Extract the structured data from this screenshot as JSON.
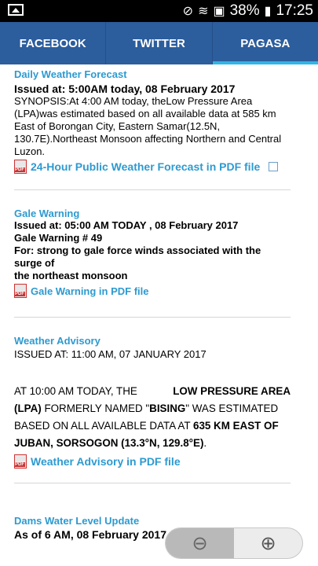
{
  "status_bar": {
    "battery": "38%",
    "time": "17:25",
    "icons": [
      "gallery-icon",
      "muted-icon",
      "wifi-icon",
      "no-sim-icon",
      "battery-charging-icon"
    ]
  },
  "tabs": [
    {
      "label": "FACEBOOK"
    },
    {
      "label": "TWITTER"
    },
    {
      "label": "PAGASA",
      "active": true
    }
  ],
  "forecast": {
    "title": "Daily Weather Forecast",
    "issued": "Issued at: 5:00AM today, 08 February 2017",
    "synopsis_lines": [
      "SYNOPSIS:At 4:00 AM today, theLow Pressure Area",
      "(LPA)was estimated based on all available data at 585 km",
      "East of Borongan City, Eastern Samar(12.5N,",
      "130.7E).Northeast Monsoon affecting Northern and Central",
      "Luzon."
    ],
    "pdf_link": "24-Hour Public Weather Forecast in PDF file"
  },
  "gale": {
    "title": "Gale Warning",
    "issued": "Issued at: 05:00 AM TODAY , 08 February 2017",
    "number": "Gale Warning # 49",
    "for_line_1": "For: strong to gale force winds associated with the surge of",
    "for_line_2": "the northeast monsoon",
    "pdf_link": "Gale Warning in PDF file"
  },
  "advisory": {
    "title": "Weather Advisory",
    "issued": "ISSUED AT: 11:00 AM, 07 JANUARY 2017",
    "p1_a": "AT 10:00 AM TODAY, THE ",
    "p1_b": "LOW PRESSURE AREA",
    "p2_a": "(LPA)",
    "p2_b": " FORMERLY NAMED \"",
    "p2_c": "BISING",
    "p2_d": "\" WAS ESTIMATED",
    "p3_a": "BASED ON ALL AVAILABLE DATA AT ",
    "p3_b": "635 KM EAST OF",
    "p4_a": "JUBAN, SORSOGON (13.3°N, 129.8°E)",
    "p4_b": ".",
    "pdf_link": "Weather Advisory in PDF file"
  },
  "dams": {
    "title": "Dams Water Level Update",
    "asof": "As of 6 AM, 08 February  2017"
  },
  "zoom": {
    "out": "zoom-out-icon",
    "in": "zoom-in-icon"
  }
}
